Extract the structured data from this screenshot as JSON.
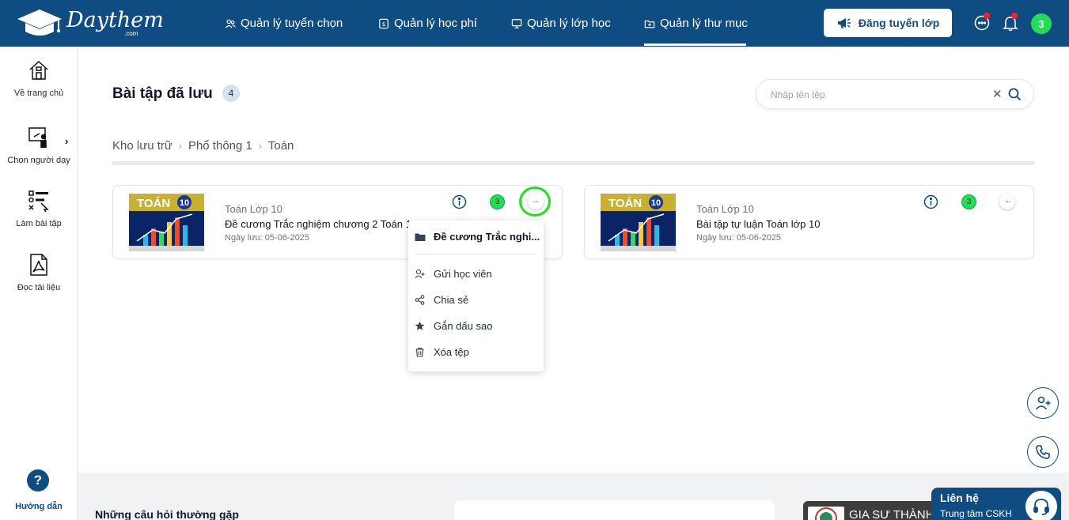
{
  "brand": {
    "name": "Daythem",
    "sub": ".com"
  },
  "nav": {
    "items": [
      {
        "label": "Quản lý tuyển chọn"
      },
      {
        "label": "Quản lý học phí"
      },
      {
        "label": "Quản lý lớp học"
      },
      {
        "label": "Quản lý thư mục"
      }
    ],
    "active_index": 3,
    "post_button": "Đăng tuyển lớp",
    "avatar_count": "3"
  },
  "sidebar": {
    "items": [
      {
        "label": "Về trang chủ",
        "icon": "home-icon"
      },
      {
        "label": "Chọn người dạy",
        "icon": "teacher-board-icon"
      },
      {
        "label": "Làm bài tập",
        "icon": "exercise-icon"
      },
      {
        "label": "Đọc tài liệu",
        "icon": "pdf-icon"
      }
    ],
    "chevron": "›",
    "help_symbol": "?",
    "help_label": "Hướng dẫn"
  },
  "page": {
    "title": "Bài tập đã lưu",
    "count": "4"
  },
  "search": {
    "placeholder": "Nhập tên tệp",
    "clear": "✕"
  },
  "breadcrumb": [
    "Kho lưu trữ",
    "Phổ thông 1",
    "Toán"
  ],
  "breadcrumb_sep": "›",
  "cards": [
    {
      "subject": "Toán Lớp 10",
      "title": "Đề cương Trắc nghiệm chương 2 Toán 10",
      "date": "Ngày lưu: 05-06-2025",
      "badge": "3",
      "thumb_label": "TOÁN",
      "thumb_grade": "10"
    },
    {
      "subject": "Toán Lớp 10",
      "title": "Bài tập tự luận Toán lớp 10",
      "date": "Ngày lưu: 05-06-2025",
      "badge": "3",
      "thumb_label": "TOÁN",
      "thumb_grade": "10"
    }
  ],
  "more_symbol": "···",
  "context_menu": {
    "header": "Đề cương Trắc nghi...",
    "items": [
      {
        "label": "Gửi học viên",
        "icon": "user-plus-icon"
      },
      {
        "label": "Chia sẻ",
        "icon": "share-icon"
      },
      {
        "label": "Gắn dấu sao",
        "icon": "star-icon"
      },
      {
        "label": "Xóa tệp",
        "icon": "trash-icon"
      }
    ]
  },
  "footer": {
    "faq_title": "Những câu hỏi thường gặp",
    "promo_text": "GIA SƯ THÀNH",
    "contact_title": "Liên hệ",
    "contact_sub": "Trung tâm CSKH"
  },
  "colors": {
    "primary": "#0f4c81",
    "accent_green": "#22dd55",
    "highlight": "#1fe01f",
    "notify_red": "#ff1f1f"
  }
}
